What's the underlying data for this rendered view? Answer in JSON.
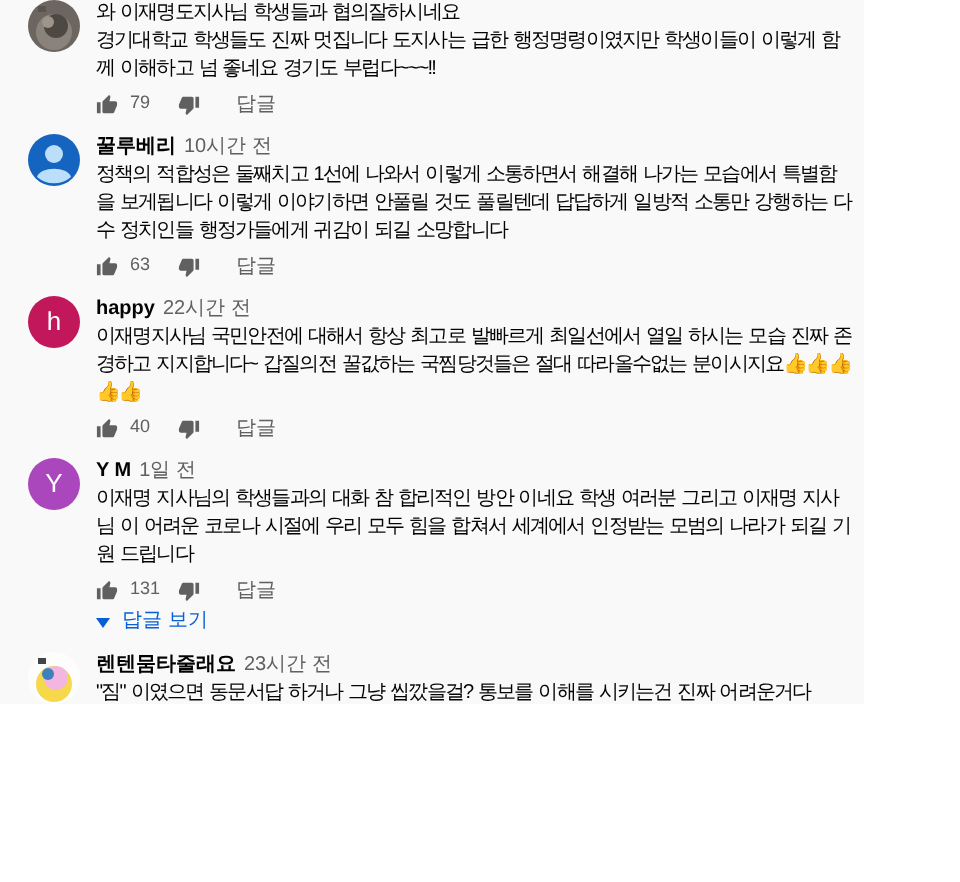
{
  "comments": [
    {
      "avatar": {
        "kind": "picture"
      },
      "paragraphs": [
        "와 이재명도지사님 학생들과 협의잘하시네요",
        "경기대학교 학생들도 진짜 멋집니다  도지사는 급한 행정명령이였지만  학생이들이  이렇게  함께 이해하고 넘 좋네요  경기도 부럽다~~~!!"
      ],
      "likes": "79",
      "reply_label": "답글"
    },
    {
      "avatar": {
        "kind": "user",
        "color": "#1565c0"
      },
      "author": "꿀루베리",
      "time": "10시간 전",
      "paragraphs": [
        "정책의 적합성은 둘째치고 1선에 나와서 이렇게 소통하면서 해결해 나가는 모습에서 특별함을 보게됩니다 이렇게 이야기하면 안풀릴 것도 풀릴텐데 답답하게 일방적 소통만 강행하는 다수 정치인들 행정가들에게 귀감이 되길 소망합니다"
      ],
      "likes": "63",
      "reply_label": "답글"
    },
    {
      "avatar": {
        "kind": "letter",
        "letter": "h",
        "color": "#c2185b"
      },
      "author": "happy",
      "time": "22시간 전",
      "paragraphs": [
        "이재명지사님 국민안전에 대해서 항상 최고로 발빠르게 최일선에서 열일 하시는 모습 진짜 존경하고 지지합니다~ 갑질의전 꿀값하는 국찜당것들은 절대 따라올수없는 분이시지요👍👍👍👍👍"
      ],
      "likes": "40",
      "reply_label": "답글"
    },
    {
      "avatar": {
        "kind": "letter",
        "letter": "Y",
        "color": "#ab47bc"
      },
      "author": "Y M",
      "time": "1일 전",
      "paragraphs": [
        "이재명 지사님의 학생들과의 대화 참 합리적인 방안 이네요 학생 여러분 그리고 이재명 지사님 이 어려운 코로나 시절에 우리 모두 힘을 합쳐서 세계에서 인정받는 모범의 나라가 되길 기원 드립니다"
      ],
      "likes": "131",
      "reply_label": "답글",
      "replies_label": "답글 보기"
    },
    {
      "avatar": {
        "kind": "picture"
      },
      "author": "렌텐뭄타줄래요",
      "time": "23시간 전",
      "paragraphs": [
        "\"짐\" 이였으면 동문서답 하거나 그냥 씹깠을걸?  통보를 이해를 시키는건 진짜 어려운거다"
      ]
    }
  ]
}
